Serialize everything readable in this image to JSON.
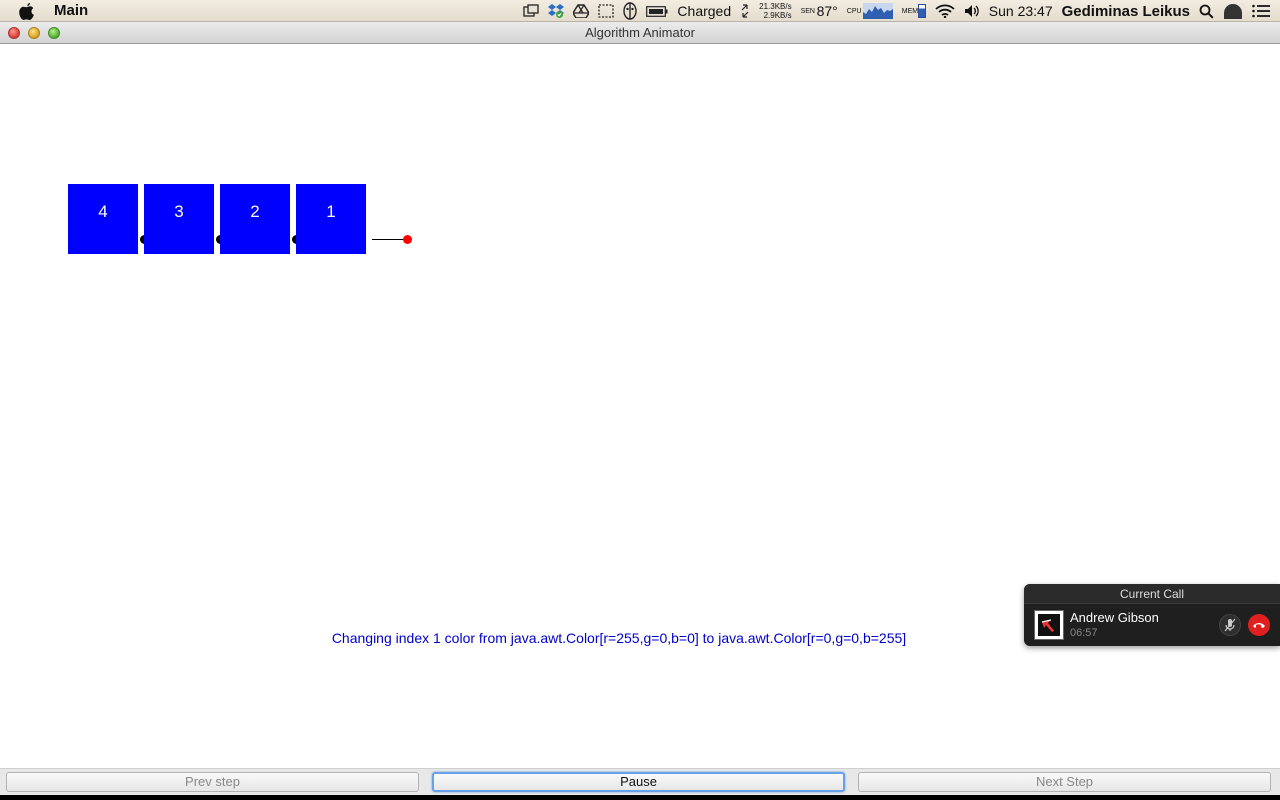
{
  "menubar": {
    "app_name": "Main",
    "battery_label": "Charged",
    "net_up": "21.3KB/s",
    "net_down": "2.9KB/s",
    "sensor_label": "SEN",
    "temperature": "87°",
    "cpu_label": "CPU",
    "mem_label": "MEM",
    "clock": "Sun 23:47",
    "user": "Gediminas Leikus"
  },
  "window": {
    "title": "Algorithm Animator"
  },
  "list": {
    "nodes": [
      "4",
      "3",
      "2",
      "1"
    ],
    "node_color": "#0000ff",
    "null_pointer_color": "#ff0000"
  },
  "status_message": "Changing index 1 color from java.awt.Color[r=255,g=0,b=0] to java.awt.Color[r=0,g=0,b=255]",
  "call": {
    "header": "Current Call",
    "name": "Andrew Gibson",
    "duration": "06:57"
  },
  "buttons": {
    "prev": "Prev step",
    "pause": "Pause",
    "next": "Next Step"
  }
}
